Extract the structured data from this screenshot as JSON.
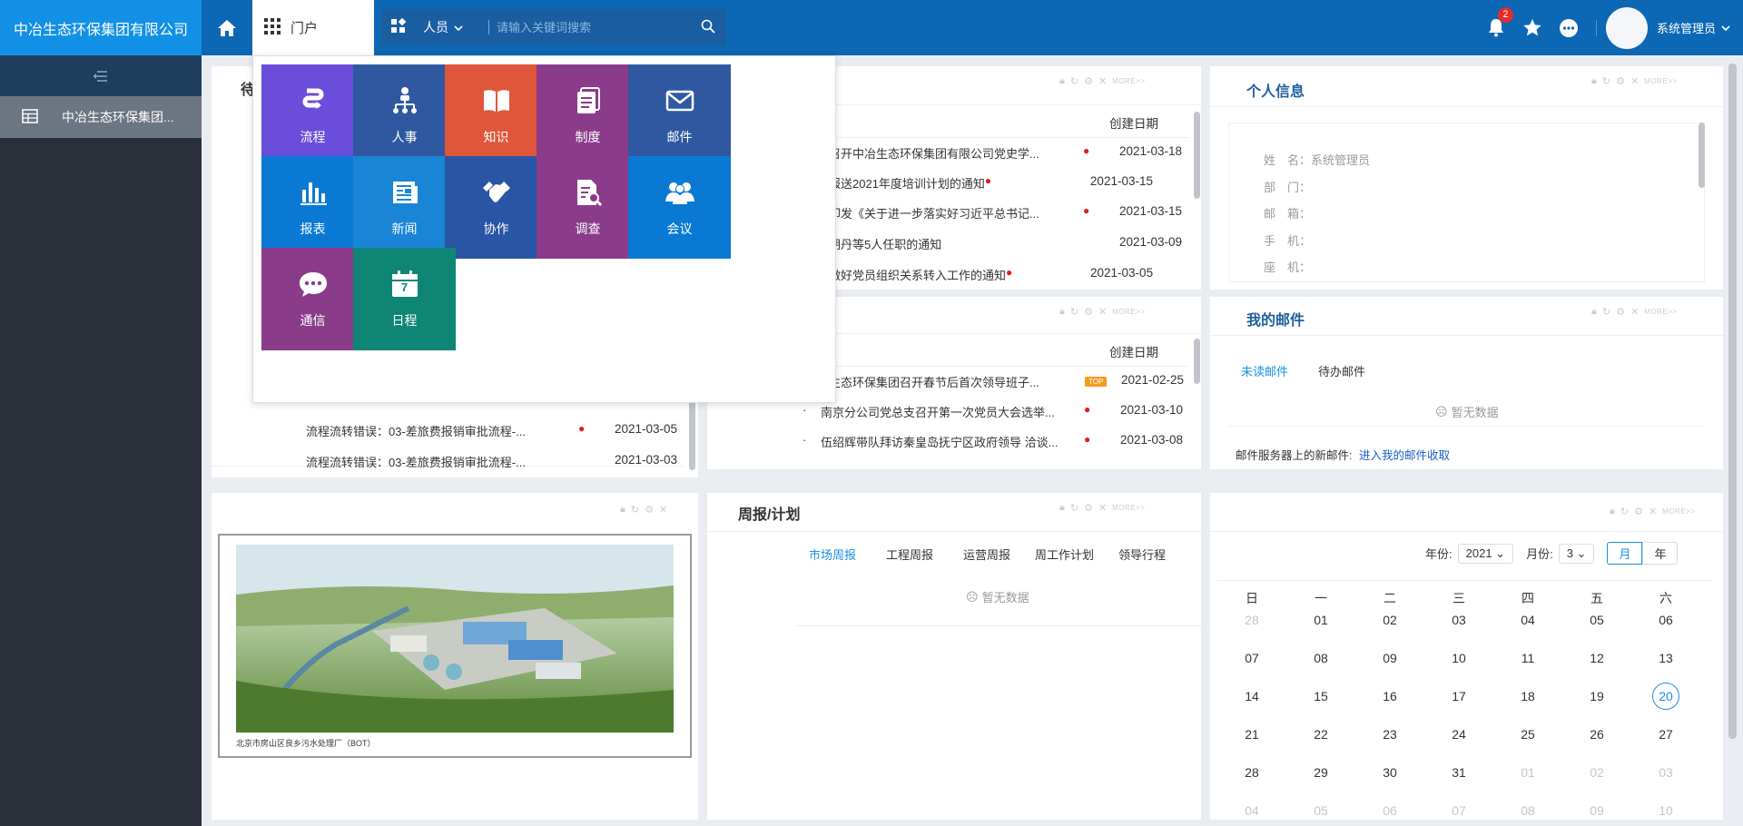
{
  "brand": "中冶生态环保集团有限公司",
  "header": {
    "portal_tab": "门户",
    "search_scope": "人员",
    "search_placeholder": "请输入关键词搜索",
    "notification_count": "2",
    "user_name": "系统管理员"
  },
  "sidebar": {
    "items": [
      {
        "label": "中冶生态环保集团..."
      }
    ]
  },
  "tiles": [
    {
      "label": "流程",
      "icon": "workflow-icon",
      "color": "#6b4ddb"
    },
    {
      "label": "人事",
      "icon": "org-chart-icon",
      "color": "#2f58a0"
    },
    {
      "label": "知识",
      "icon": "book-icon",
      "color": "#e0563b"
    },
    {
      "label": "制度",
      "icon": "document-stack-icon",
      "color": "#8a3c8a"
    },
    {
      "label": "邮件",
      "icon": "mail-icon",
      "color": "#2f58a0"
    },
    {
      "label": "报表",
      "icon": "bar-chart-icon",
      "color": "#0a79d4"
    },
    {
      "label": "新闻",
      "icon": "newspaper-icon",
      "color": "#1a84d6"
    },
    {
      "label": "协作",
      "icon": "handshake-icon",
      "color": "#2a55a4"
    },
    {
      "label": "调查",
      "icon": "survey-icon",
      "color": "#8a3c8a"
    },
    {
      "label": "会议",
      "icon": "people-icon",
      "color": "#0a79d4"
    },
    {
      "label": "通信",
      "icon": "chat-icon",
      "color": "#8a3c8a"
    },
    {
      "label": "日程",
      "icon": "calendar-icon",
      "color": "#0f8575",
      "day": "7"
    }
  ],
  "todo_panel": {
    "title_fragment": "待",
    "rows": [
      {
        "title": "流程流转错误：03-差旅费报销审批流程-...",
        "date": "2021-03-05",
        "dot": true
      },
      {
        "title": "流程流转错误：03-差旅费报销审批流程-...",
        "date": "2021-03-03",
        "dot": false
      }
    ]
  },
  "news_panel_1": {
    "date_header": "创建日期",
    "rows": [
      {
        "title": "召开中冶生态环保集团有限公司党史学...",
        "date": "2021-03-18",
        "dot": true
      },
      {
        "title": "报送2021年度培训计划的通知",
        "date": "2021-03-15",
        "dot": true
      },
      {
        "title": "印发《关于进一步落实好习近平总书记...",
        "date": "2021-03-15",
        "dot": true
      },
      {
        "title": "胡丹等5人任职的通知",
        "date": "2021-03-09",
        "dot": false
      },
      {
        "title": "做好党员组织关系转入工作的通知",
        "date": "2021-03-05",
        "dot": true
      }
    ]
  },
  "news_panel_2": {
    "date_header": "创建日期",
    "rows": [
      {
        "title": "生态环保集团召开春节后首次领导班子...",
        "date": "2021-02-25",
        "top": "TOP"
      },
      {
        "title": "南京分公司党总支召开第一次党员大会选举...",
        "date": "2021-03-10",
        "dot": true
      },
      {
        "title": "伍绍辉带队拜访秦皇岛抚宁区政府领导 洽谈...",
        "date": "2021-03-08",
        "dot": true
      }
    ]
  },
  "personal_info": {
    "title": "个人信息",
    "fields": [
      {
        "label": "姓　名：",
        "value": "系统管理员"
      },
      {
        "label": "部　门：",
        "value": ""
      },
      {
        "label": "邮　箱：",
        "value": ""
      },
      {
        "label": "手　机：",
        "value": ""
      },
      {
        "label": "座　机：",
        "value": ""
      }
    ]
  },
  "mail_panel": {
    "title": "我的邮件",
    "tabs": [
      "未读邮件",
      "待办邮件"
    ],
    "empty": "暂无数据",
    "server_text": "邮件服务器上的新邮件:",
    "server_link": "进入我的邮件收取"
  },
  "image_panel": {
    "caption": "北京市房山区良乡污水处理厂（BOT）"
  },
  "weekly_panel": {
    "title": "周报/计划",
    "tabs": [
      "市场周报",
      "工程周报",
      "运营周报",
      "周工作计划",
      "领导行程"
    ],
    "empty": "暂无数据"
  },
  "calendar": {
    "year_label": "年份:",
    "year": "2021",
    "month_label": "月份:",
    "month": "3",
    "view_month": "月",
    "view_year": "年",
    "weekdays": [
      "日",
      "一",
      "二",
      "三",
      "四",
      "五",
      "六"
    ],
    "weeks": [
      [
        "28",
        "01",
        "02",
        "03",
        "04",
        "05",
        "06"
      ],
      [
        "07",
        "08",
        "09",
        "10",
        "11",
        "12",
        "13"
      ],
      [
        "14",
        "15",
        "16",
        "17",
        "18",
        "19",
        "20"
      ],
      [
        "21",
        "22",
        "23",
        "24",
        "25",
        "26",
        "27"
      ],
      [
        "28",
        "29",
        "30",
        "31",
        "01",
        "02",
        "03"
      ],
      [
        "04",
        "05",
        "06",
        "07",
        "08",
        "09",
        "10"
      ]
    ],
    "today": "20"
  },
  "tool_more": "MORE>>"
}
